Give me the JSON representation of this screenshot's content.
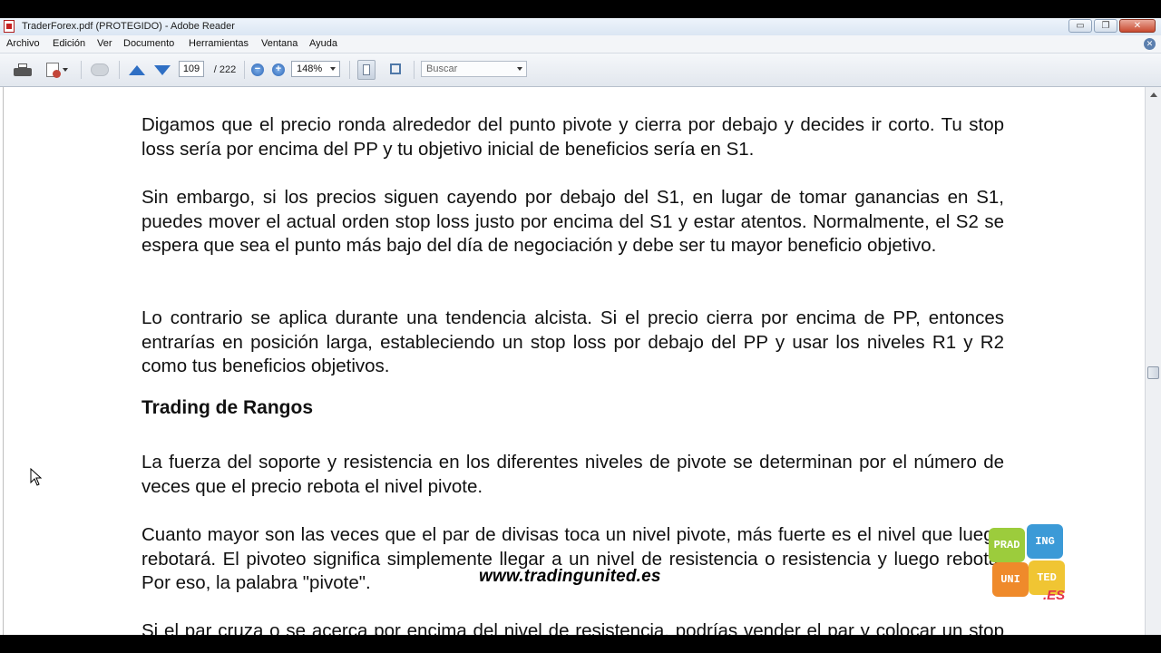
{
  "window": {
    "title": "TraderForex.pdf (PROTEGIDO) - Adobe Reader",
    "buttons": {
      "minimize": "▭",
      "restore": "❐",
      "close": "✕"
    }
  },
  "menu": [
    "Archivo",
    "Edición",
    "Ver",
    "Documento",
    "Herramientas",
    "Ventana",
    "Ayuda"
  ],
  "menu_close": "✕",
  "toolbar": {
    "current_page": "109",
    "total_pages": "/ 222",
    "zoom_minus": "−",
    "zoom_plus": "+",
    "zoom": "148%",
    "search_placeholder": "Buscar"
  },
  "document": {
    "p1": "Digamos que el precio ronda alrededor del punto pivote y cierra por debajo y decides ir corto. Tu stop loss sería por encima del PP y tu objetivo inicial de beneficios sería en S1.",
    "p2": "Sin embargo, si los precios siguen cayendo por debajo del S1, en lugar de tomar ganancias en S1, puedes mover el actual orden stop loss justo por encima del S1 y estar atentos. Normalmente, el S2 se espera que sea el punto más bajo del día de negociación y debe ser tu mayor beneficio objetivo.",
    "p3": "Lo contrario se aplica durante una tendencia alcista. Si el precio cierra por encima de PP, entonces entrarías en posición larga, estableciendo un stop loss por debajo del PP y usar los niveles R1 y R2 como tus beneficios objetivos.",
    "heading": "Trading de Rangos",
    "p4": "La fuerza del soporte y resistencia en los diferentes niveles de pivote se determinan por el número de veces que el precio rebota el nivel pivote.",
    "p5": "Cuanto mayor son las veces que el par de divisas toca un nivel pivote, más fuerte es el nivel que luego rebotará. El pivoteo significa simplemente llegar a un nivel de resistencia o resistencia y luego rebota. Por eso, la palabra \"pivote\".",
    "p6": "Si el par cruza o se acerca por encima del nivel de resistencia, podrías vender el par y colocar un stop loss de protección por encima del nivel de resistencia."
  },
  "watermark": {
    "url": "www.tradingunited.es",
    "logo": [
      "PRAD",
      "ING",
      "UNI",
      "TED"
    ],
    "logo_suffix": ".ES"
  }
}
